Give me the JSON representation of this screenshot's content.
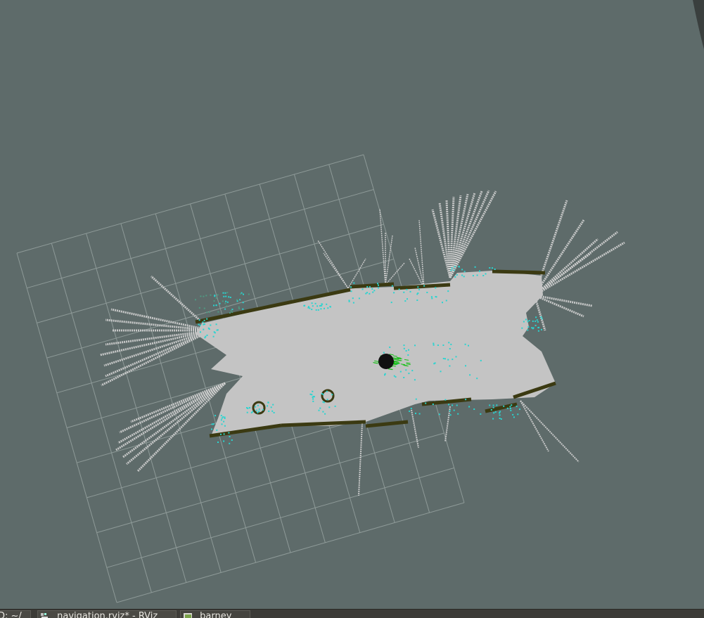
{
  "app": {
    "name": "RViz"
  },
  "viewport": {
    "background_color": "#5e6b6a",
    "grid_color": "#8e9a98",
    "free_space_color": "#c4c4c4",
    "laser_ray_color": "#d2d2d2",
    "obstacle_color": "#3b3a12",
    "inflation_color": "#29d4d0",
    "pose_cloud_color": "#19c019",
    "robot_color": "#111111",
    "grid_cells": [
      10,
      10
    ]
  },
  "taskbar": {
    "items": [
      {
        "label": "D: ~/",
        "icon": "terminal-icon"
      },
      {
        "label": "navigation.rviz* - RViz",
        "icon": "rviz-icon"
      },
      {
        "label": "barney",
        "icon": "folder-icon"
      }
    ]
  }
}
